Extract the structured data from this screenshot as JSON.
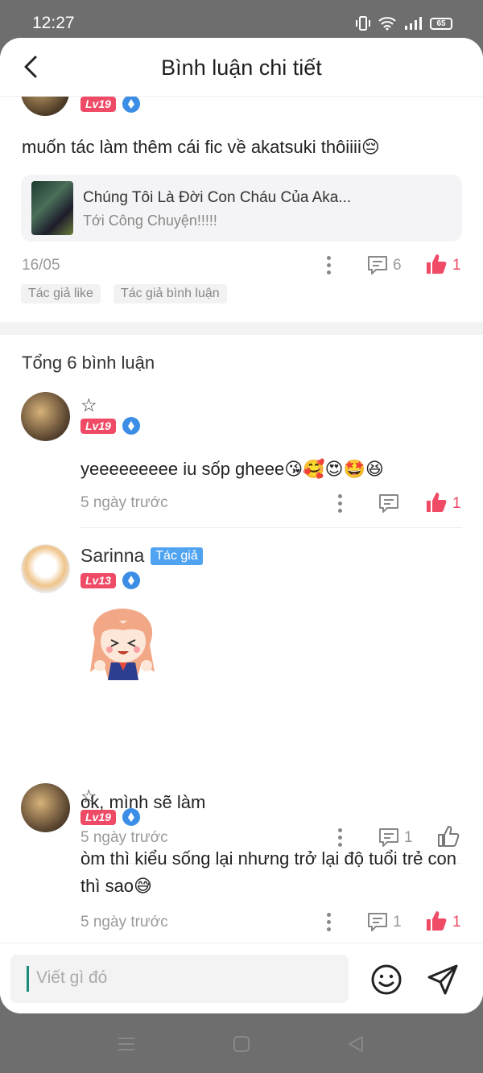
{
  "status": {
    "time": "12:27",
    "battery": "65"
  },
  "header": {
    "title": "Bình luận chi tiết"
  },
  "top_comment": {
    "level": "Lv19",
    "text": "muốn tác làm thêm cái fic về akatsuki thôiiii😔",
    "story": {
      "title": "Chúng Tôi Là Đời Con Cháu Của Aka...",
      "subtitle": "Tới Công Chuyện!!!!!"
    },
    "date": "16/05",
    "reply_count": "6",
    "like_count": "1",
    "tags": [
      "Tác giả like",
      "Tác giả bình luận"
    ]
  },
  "total_label": "Tổng 6 bình luận",
  "comments": [
    {
      "name": "☆",
      "level": "Lv19",
      "author_tag": "",
      "text": "yeeeeeeeee iu sốp gheee😘🥰😍🤩😆",
      "time": "5 ngày trước",
      "reply_count": "",
      "like_count": "1",
      "liked": true
    },
    {
      "name": "Sarinna",
      "level": "Lv13",
      "author_tag": "Tác giả",
      "text": "ok, mình sẽ làm",
      "time": "5 ngày trước",
      "reply_count": "1",
      "like_count": "",
      "liked": false
    },
    {
      "name": "☆",
      "level": "Lv19",
      "author_tag": "",
      "text": "òm thì kiểu sống lại nhưng trở lại độ tuổi trẻ con thì sao😅",
      "time": "5 ngày trước",
      "reply_count": "1",
      "like_count": "1",
      "liked": true
    }
  ],
  "input": {
    "placeholder": "Viết gì đó"
  },
  "colors": {
    "accent_like": "#ef4a66",
    "author_tag": "#4fa3f0",
    "level_badge": "#ef4a66"
  }
}
